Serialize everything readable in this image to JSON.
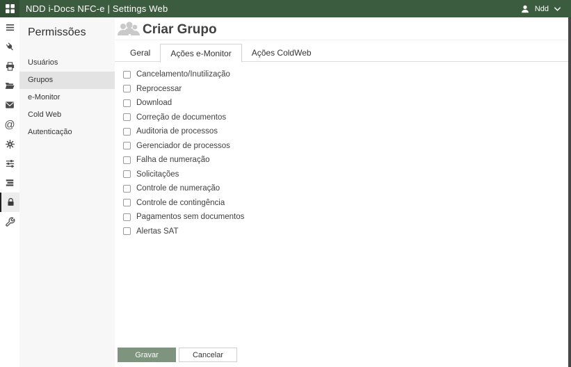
{
  "topbar": {
    "title": "NDD i-Docs NFC-e | Settings Web",
    "user_label": "Ndd",
    "colors": {
      "bar_bg": "#3b5c3e",
      "logo_bg": "#2f4e33"
    },
    "icons": [
      "apps-grid",
      "user",
      "chevron-down"
    ]
  },
  "icon_rail": {
    "selected": "lock",
    "icons": [
      "menu",
      "plug",
      "printer",
      "folder-open",
      "mail",
      "at-sign",
      "gear",
      "sliders",
      "stack",
      "lock",
      "wrench"
    ]
  },
  "sidebar": {
    "title": "Permissões",
    "items": [
      {
        "label": "Usuários",
        "selected": false
      },
      {
        "label": "Grupos",
        "selected": true
      },
      {
        "label": "e-Monitor",
        "selected": false
      },
      {
        "label": "Cold Web",
        "selected": false
      },
      {
        "label": "Autenticação",
        "selected": false
      }
    ]
  },
  "main": {
    "page_title": "Criar Grupo",
    "header_icon": "group-people",
    "tabs": [
      {
        "label": "Geral",
        "active": false
      },
      {
        "label": "Ações e-Monitor",
        "active": true
      },
      {
        "label": "Ações ColdWeb",
        "active": false
      }
    ],
    "checkboxes": [
      {
        "label": "Cancelamento/Inutilização",
        "checked": false
      },
      {
        "label": "Reprocessar",
        "checked": false
      },
      {
        "label": "Download",
        "checked": false
      },
      {
        "label": "Correção de documentos",
        "checked": false
      },
      {
        "label": "Auditoria de processos",
        "checked": false
      },
      {
        "label": "Gerenciador de processos",
        "checked": false
      },
      {
        "label": "Falha de numeração",
        "checked": false
      },
      {
        "label": "Solicitações",
        "checked": false
      },
      {
        "label": "Controle de numeração",
        "checked": false
      },
      {
        "label": "Controle de contingência",
        "checked": false
      },
      {
        "label": "Pagamentos sem documentos",
        "checked": false
      },
      {
        "label": "Alertas SAT",
        "checked": false
      }
    ],
    "buttons": {
      "save": "Gravar",
      "cancel": "Cancelar"
    },
    "colors": {
      "save_bg": "#7e947e"
    }
  }
}
